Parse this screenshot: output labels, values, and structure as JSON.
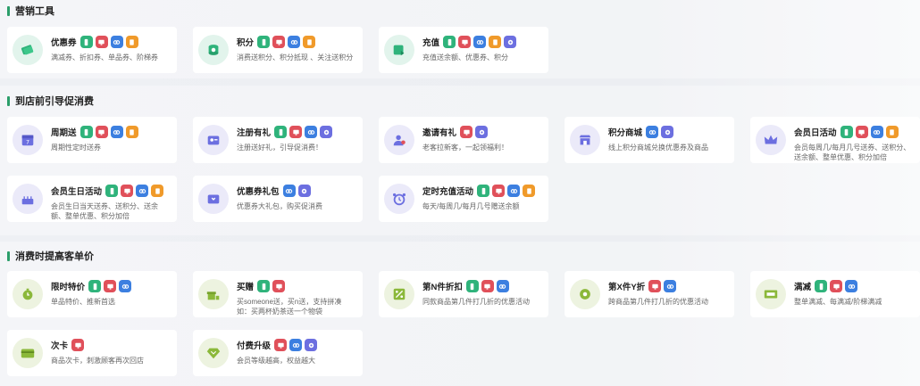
{
  "sections": [
    {
      "title": "营销工具",
      "cards": [
        {
          "name": "优惠券",
          "icon": "coupon-icon",
          "desc": "满减券、折扣券、单品券、阶梯券",
          "badges": [
            "g",
            "r",
            "bl",
            "o"
          ]
        },
        {
          "name": "积分",
          "icon": "points-icon",
          "desc": "消费送积分、积分抵现 、关注送积分",
          "badges": [
            "g",
            "r",
            "bl",
            "o"
          ]
        },
        {
          "name": "充值",
          "icon": "recharge-icon",
          "desc": "充值送余额、优惠券、积分",
          "badges": [
            "g",
            "r",
            "bl",
            "o",
            "p"
          ]
        }
      ]
    },
    {
      "title": "到店前引导促消费",
      "cards": [
        {
          "name": "周期送",
          "icon": "calendar-icon",
          "desc": "周期性定时送券",
          "badges": [
            "g",
            "r",
            "bl",
            "o"
          ]
        },
        {
          "name": "注册有礼",
          "icon": "register-icon",
          "desc": "注册送好礼，引导促消费！",
          "badges": [
            "g",
            "r",
            "bl",
            "p"
          ]
        },
        {
          "name": "邀请有礼",
          "icon": "invite-icon",
          "desc": "老客拉新客，一起领福利！",
          "badges": [
            "r",
            "p"
          ]
        },
        {
          "name": "积分商城",
          "icon": "store-icon",
          "desc": "线上积分商城兑换优惠券及商品",
          "badges": [
            "bl",
            "p"
          ]
        },
        {
          "name": "会员日活动",
          "icon": "crown-icon",
          "desc": "会员每周几/每月几号送券、送积分、送余额、整单优惠、积分加倍",
          "badges": [
            "g",
            "r",
            "bl",
            "o"
          ]
        },
        {
          "name": "会员生日活动",
          "icon": "cake-icon",
          "desc": "会员生日当天送券、送积分、送余额、整单优惠、积分加倍",
          "badges": [
            "g",
            "r",
            "bl",
            "o"
          ]
        },
        {
          "name": "优惠券礼包",
          "icon": "gift-pack-icon",
          "desc": "优惠券大礼包，购买促消费",
          "badges": [
            "bl",
            "p"
          ]
        },
        {
          "name": "定时充值活动",
          "icon": "alarm-icon",
          "desc": "每天/每周几/每月几号赠送余额",
          "badges": [
            "g",
            "r",
            "bl",
            "o"
          ]
        }
      ]
    },
    {
      "title": "消费时提高客单价",
      "cards": [
        {
          "name": "限时特价",
          "icon": "timer-icon",
          "desc": "单品特价、推新首选",
          "badges": [
            "g",
            "r",
            "bl"
          ]
        },
        {
          "name": "买赠",
          "icon": "buy-gift-icon",
          "desc": "买someone送，买n送，支持拼凑 如：买两杯奶茶送一个物袋",
          "badges": [
            "g",
            "r"
          ]
        },
        {
          "name": "第N件折扣",
          "icon": "percent-icon",
          "desc": "同款商品第几件打几折的优惠活动",
          "badges": [
            "g",
            "r",
            "bl"
          ]
        },
        {
          "name": "第X件Y折",
          "icon": "gear-discount-icon",
          "desc": "跨商品第几件打几折的优惠活动",
          "badges": [
            "r",
            "bl"
          ]
        },
        {
          "name": "满减",
          "icon": "full-reduction-icon",
          "desc": "整单满减、每满减/阶梯满减",
          "badges": [
            "g",
            "r",
            "bl"
          ]
        },
        {
          "name": "次卡",
          "icon": "card-icon",
          "desc": "商品次卡，刺激顾客再次回店",
          "badges": [
            "r"
          ]
        },
        {
          "name": "付费升级",
          "icon": "diamond-icon",
          "desc": "会员等级越高，权益越大",
          "badges": [
            "r",
            "bl",
            "p"
          ]
        }
      ]
    }
  ]
}
